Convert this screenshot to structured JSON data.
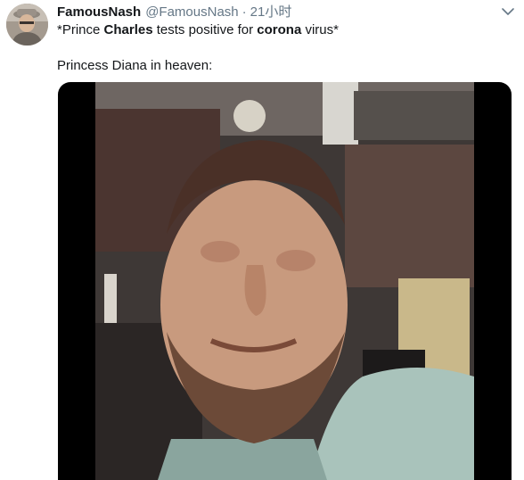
{
  "tweet": {
    "display_name": "FamousNash",
    "handle": "@FamousNash",
    "separator": "·",
    "timestamp": "21小时",
    "line1": {
      "part1": "*Prince ",
      "part2": "Charles",
      "part3": " tests positive for ",
      "part4": "corona",
      "part5": " virus*"
    },
    "line2": "Princess Diana in heaven:"
  },
  "icons": {
    "avatar": "profile-photo",
    "caret": "chevron-down-icon"
  },
  "colors": {
    "text_primary": "#14171a",
    "text_secondary": "#657786",
    "media_background": "#000000"
  }
}
